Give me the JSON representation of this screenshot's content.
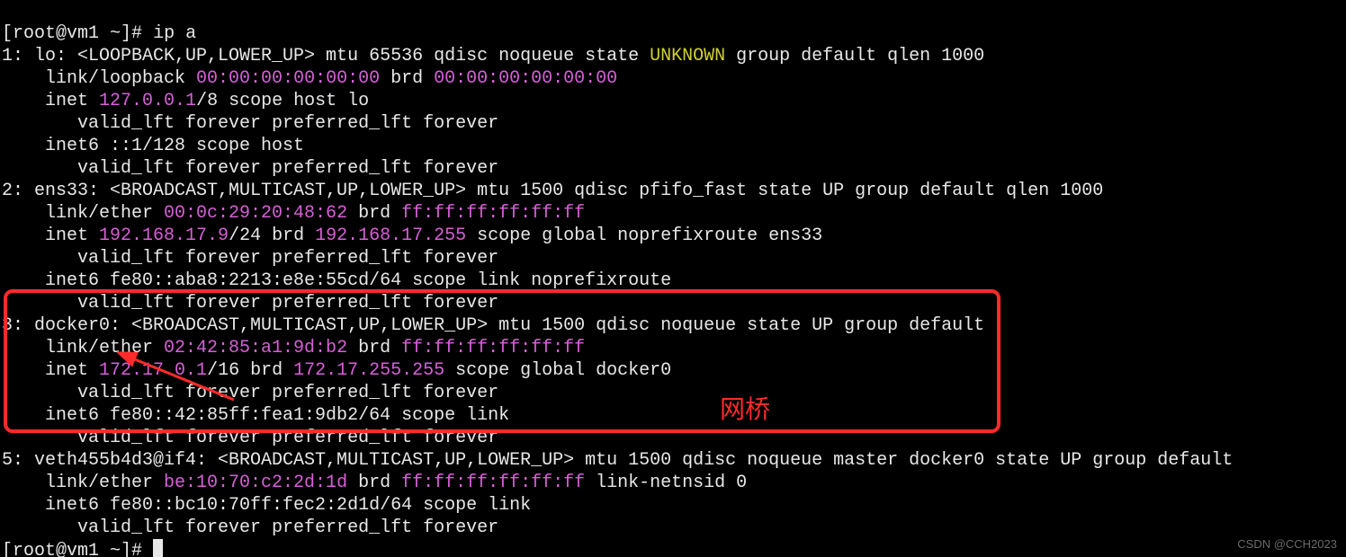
{
  "prompt_open": "[",
  "prompt_user": "root@vm1",
  "prompt_sep": " ~",
  "prompt_close": "]# ",
  "command": "ip a",
  "lo": {
    "hdr_a": "1: lo: <LOOPBACK,UP,LOWER_UP> mtu 65536 qdisc noqueue state ",
    "state": "UNKNOWN",
    "hdr_b": " group default qlen 1000",
    "link_a": "    link/loopback ",
    "mac": "00:00:00:00:00:00",
    "brd_lbl": " brd ",
    "brd": "00:00:00:00:00:00",
    "inet_a": "    inet ",
    "ip": "127.0.0.1",
    "inet_b": "/8 scope host lo",
    "valid": "       valid_lft forever preferred_lft forever",
    "inet6": "    inet6 ::1/128 scope host ",
    "valid2": "       valid_lft forever preferred_lft forever"
  },
  "ens33": {
    "hdr": "2: ens33: <BROADCAST,MULTICAST,UP,LOWER_UP> mtu 1500 qdisc pfifo_fast state UP group default qlen 1000",
    "link_a": "    link/ether ",
    "mac": "00:0c:29:20:48:62",
    "brd_lbl": " brd ",
    "brd": "ff:ff:ff:ff:ff:ff",
    "inet_a": "    inet ",
    "ip": "192.168.17.9",
    "inet_b": "/24 brd ",
    "ipbrd": "192.168.17.255",
    "inet_c": " scope global noprefixroute ens33",
    "valid": "       valid_lft forever preferred_lft forever",
    "inet6": "    inet6 fe80::aba8:2213:e8e:55cd/64 scope link noprefixroute ",
    "valid2": "       valid_lft forever preferred_lft forever"
  },
  "docker0": {
    "hdr": "3: docker0: <BROADCAST,MULTICAST,UP,LOWER_UP> mtu 1500 qdisc noqueue state UP group default ",
    "link_a": "    link/ether ",
    "mac": "02:42:85:a1:9d:b2",
    "brd_lbl": " brd ",
    "brd": "ff:ff:ff:ff:ff:ff",
    "inet_a": "    inet ",
    "ip": "172.17.0.1",
    "inet_b": "/16 brd ",
    "ipbrd": "172.17.255.255",
    "inet_c": " scope global docker0",
    "valid": "       valid_lft forever preferred_lft forever",
    "inet6": "    inet6 fe80::42:85ff:fea1:9db2/64 scope link ",
    "valid2": "       valid_lft forever preferred_lft forever"
  },
  "veth": {
    "hdr": "5: veth455b4d3@if4: <BROADCAST,MULTICAST,UP,LOWER_UP> mtu 1500 qdisc noqueue master docker0 state UP group default ",
    "link_a": "    link/ether ",
    "mac": "be:10:70:c2:2d:1d",
    "brd_lbl": " brd ",
    "brd": "ff:ff:ff:ff:ff:ff",
    "link_c": " link-netnsid 0",
    "inet6": "    inet6 fe80::bc10:70ff:fec2:2d1d/64 scope link ",
    "valid": "       valid_lft forever preferred_lft forever"
  },
  "annotation": "网桥",
  "watermark": "CSDN @CCH2023"
}
